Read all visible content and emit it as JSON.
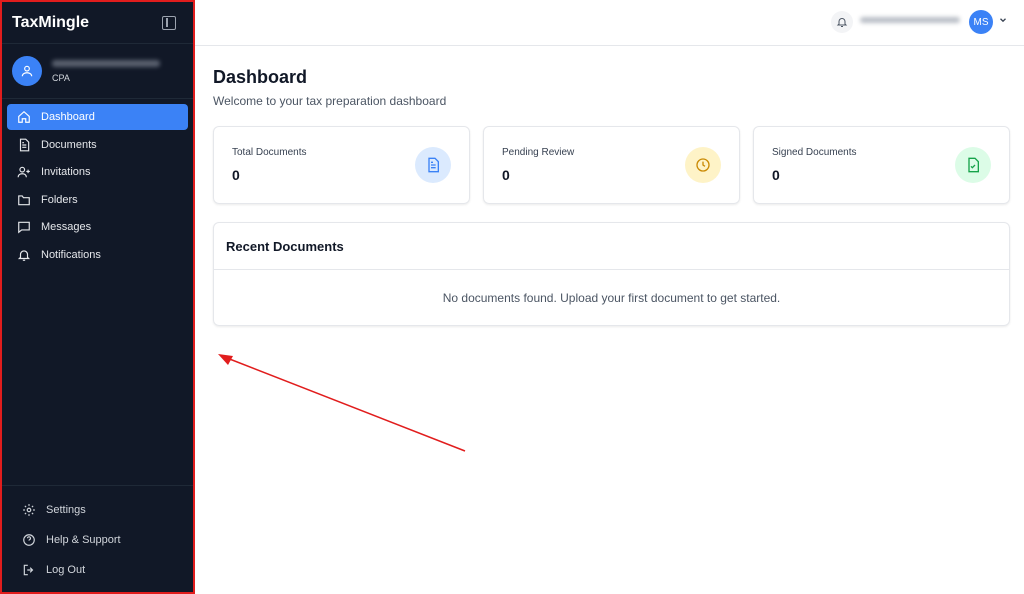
{
  "sidebar": {
    "brand": "TaxMingle",
    "profile_role": "CPA",
    "items": [
      {
        "label": "Dashboard",
        "icon": "home-icon",
        "active": true
      },
      {
        "label": "Documents",
        "icon": "document-icon"
      },
      {
        "label": "Invitations",
        "icon": "user-plus-icon"
      },
      {
        "label": "Folders",
        "icon": "folder-icon"
      },
      {
        "label": "Messages",
        "icon": "message-icon"
      },
      {
        "label": "Notifications",
        "icon": "bell-icon"
      }
    ],
    "bottom_items": [
      {
        "label": "Settings",
        "icon": "gear-icon"
      },
      {
        "label": "Help & Support",
        "icon": "help-icon"
      },
      {
        "label": "Log Out",
        "icon": "logout-icon"
      }
    ]
  },
  "header": {
    "avatar_initials": "MS"
  },
  "main": {
    "title": "Dashboard",
    "subtitle": "Welcome to your tax preparation dashboard",
    "cards": [
      {
        "label": "Total Documents",
        "value": "0",
        "icon": "document-icon",
        "color": "#3b82f6",
        "bg": "#dbeafe"
      },
      {
        "label": "Pending Review",
        "value": "0",
        "icon": "clock-icon",
        "color": "#ca8a04",
        "bg": "#fef3c7"
      },
      {
        "label": "Signed Documents",
        "value": "0",
        "icon": "file-check-icon",
        "color": "#16a34a",
        "bg": "#dcfce7"
      }
    ],
    "recent": {
      "title": "Recent Documents",
      "empty_text": "No documents found. Upload your first document to get started."
    }
  },
  "colors": {
    "sidebar_bg": "#111827",
    "accent": "#3b82f6",
    "annotation": "#e11d1d"
  }
}
